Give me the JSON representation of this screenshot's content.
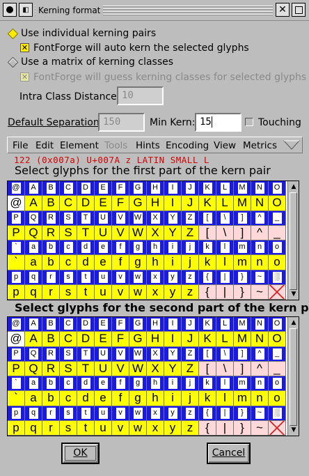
{
  "window": {
    "title": "Kerning format"
  },
  "options": {
    "individual_pairs": "Use individual kerning pairs",
    "auto_kern": "FontForge will auto kern the selected glyphs",
    "matrix_classes": "Use a matrix of kerning classes",
    "guess_classes": "FontForge will guess kerning classes for selected glyphs",
    "intra_class_label": "Intra Class Distance:",
    "intra_class_value": "10",
    "default_sep_label": "Default Separation:",
    "default_sep_value": "150",
    "min_kern_label": "Min Kern:",
    "min_kern_value": "15",
    "touching_label": "Touching"
  },
  "menu": [
    "File",
    "Edit",
    "Element",
    "Tools",
    "Hints",
    "Encoding",
    "View",
    "Metrics"
  ],
  "glyph_info": "122    (0x007a) U+007A   z   LATIN SMALL L",
  "prompts": {
    "first": "Select glyphs for the first part of the kern pair",
    "second": "Select glyphs for the second part of the kern pai"
  },
  "grid_rows": [
    [
      "@",
      "A",
      "B",
      "C",
      "D",
      "E",
      "F",
      "G",
      "H",
      "I",
      "J",
      "K",
      "L",
      "M",
      "N",
      "O"
    ],
    [
      "P",
      "Q",
      "R",
      "S",
      "T",
      "U",
      "V",
      "W",
      "X",
      "Y",
      "Z",
      "[",
      "\\",
      "]",
      "^",
      "_"
    ],
    [
      "`",
      "a",
      "b",
      "c",
      "d",
      "e",
      "f",
      "g",
      "h",
      "i",
      "j",
      "k",
      "l",
      "m",
      "n",
      "o"
    ],
    [
      "p",
      "q",
      "r",
      "s",
      "t",
      "u",
      "v",
      "w",
      "x",
      "y",
      "z",
      "{",
      "|",
      "}",
      "~",
      "░"
    ]
  ],
  "buttons": {
    "ok": "OK",
    "cancel": "Cancel"
  },
  "colors": {
    "selected": "#ffff00",
    "unselected": "#ffd9d9",
    "label_bar": "#1a1ae6",
    "info_text": "#d40000"
  }
}
